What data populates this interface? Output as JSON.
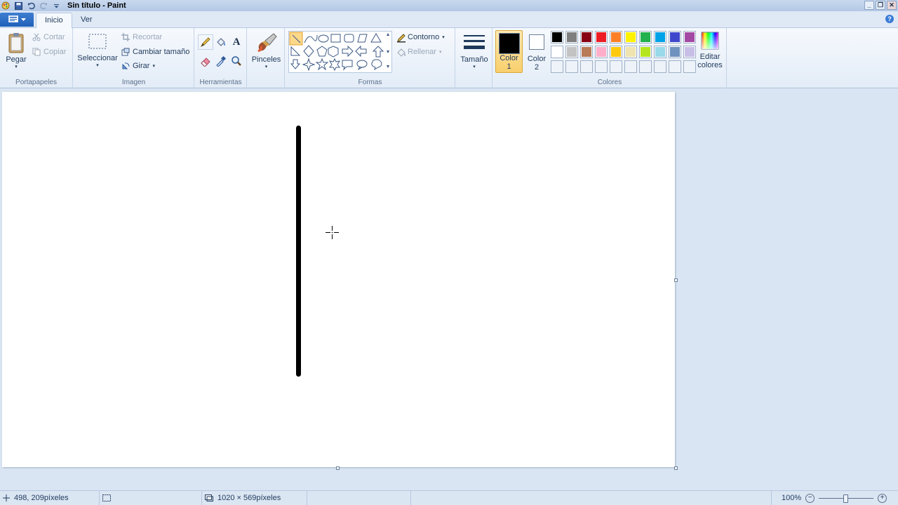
{
  "window": {
    "title": "Sin título - Paint"
  },
  "tabs": {
    "file_icon": "paint-menu-icon",
    "home": "Inicio",
    "view": "Ver"
  },
  "clipboard": {
    "label": "Portapapeles",
    "paste": "Pegar",
    "cut": "Cortar",
    "copy": "Copiar"
  },
  "image": {
    "label": "Imagen",
    "select": "Seleccionar",
    "crop": "Recortar",
    "resize": "Cambiar tamaño",
    "rotate": "Girar"
  },
  "tools": {
    "label": "Herramientas"
  },
  "brushes": {
    "label": "Pinceles"
  },
  "shapes": {
    "label": "Formas",
    "outline": "Contorno",
    "fill": "Rellenar"
  },
  "size": {
    "label": "Tamaño"
  },
  "colors": {
    "label": "Colores",
    "color1_line1": "Color",
    "color1_line2": "1",
    "color2_line1": "Color",
    "color2_line2": "2",
    "edit_line1": "Editar",
    "edit_line2": "colores",
    "color1": "#000000",
    "color2": "#ffffff",
    "palette_row1": [
      "#000000",
      "#7f7f7f",
      "#880015",
      "#ed1c24",
      "#ff7f27",
      "#fff200",
      "#22b14c",
      "#00a2e8",
      "#3f48cc",
      "#a349a4"
    ],
    "palette_row2": [
      "#ffffff",
      "#c3c3c3",
      "#b97a57",
      "#ffaec9",
      "#ffc90e",
      "#efe4b0",
      "#b5e61d",
      "#99d9ea",
      "#7092be",
      "#c8bfe7"
    ]
  },
  "status": {
    "cursor_pos": "498, 209píxeles",
    "image_size": "1020 × 569píxeles",
    "zoom": "100%"
  }
}
